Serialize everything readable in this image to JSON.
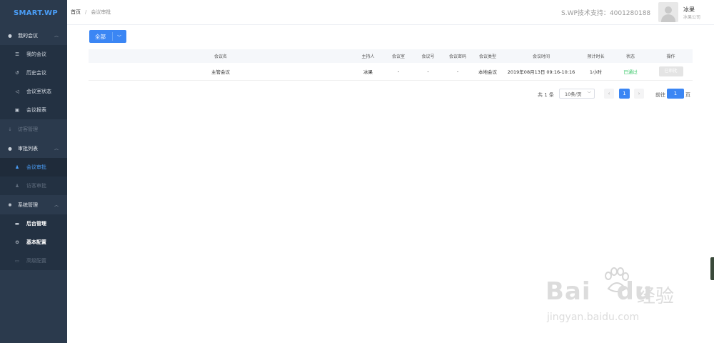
{
  "app": {
    "logo": "SMART.WP"
  },
  "sidebar": {
    "groups": [
      {
        "label": "我的会议",
        "items": [
          "我的会议",
          "历史会议",
          "会议室状态",
          "会议报表"
        ]
      },
      {
        "label": "访客管理"
      },
      {
        "label": "审批列表",
        "items": [
          "会议审批",
          "访客审批"
        ]
      },
      {
        "label": "系统管理",
        "items": [
          "后台管理",
          "基本配置",
          "高级配置"
        ]
      }
    ]
  },
  "header": {
    "breadcrumb": [
      "首页",
      "会议审批"
    ],
    "support": "S.WP技术支持：4001280188",
    "user_name": "冰果",
    "user_company": "冰果公司"
  },
  "filter": {
    "selected": "全部"
  },
  "table": {
    "columns": [
      "会议名",
      "主持人",
      "会议室",
      "会议号",
      "会议密码",
      "会议类型",
      "会议时间",
      "预计时长",
      "状态",
      "操作"
    ],
    "rows": [
      [
        "主管会议",
        "冰果",
        "-",
        "-",
        "-",
        "本地会议",
        "2019年08月13日 09:16-10:16",
        "1小时",
        "已通过",
        "已审批"
      ]
    ]
  },
  "pagination": {
    "total": "共 1 条",
    "page_size": "10条/页",
    "current": "1",
    "goto_label": "前往",
    "goto_value": "1",
    "goto_suffix": "页"
  },
  "watermark": {
    "brand": "Bai",
    "brand2": "du",
    "cn": "经验",
    "url": "jingyan.baidu.com"
  },
  "colors": {
    "sidebar": "#2b3a4d",
    "accent": "#3b86f4",
    "success": "#36c766"
  }
}
